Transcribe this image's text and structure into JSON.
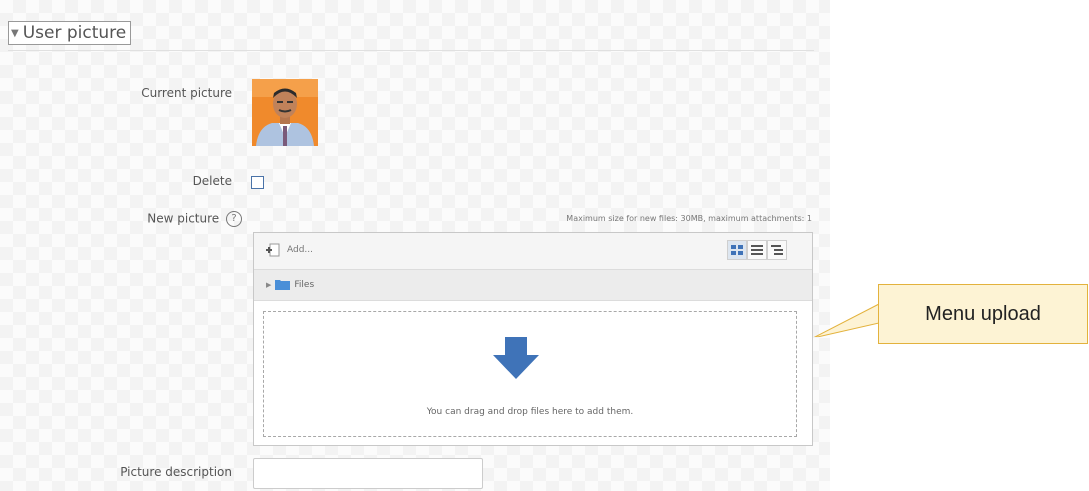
{
  "section": {
    "title": "User picture"
  },
  "current_picture": {
    "label": "Current picture"
  },
  "delete": {
    "label": "Delete",
    "checked": false
  },
  "new_picture": {
    "label": "New picture",
    "max_size_text": "Maximum size for new files: 30MB, maximum attachments: 1"
  },
  "filemanager": {
    "add_label": "Add...",
    "path_folder": "Files",
    "drop_text": "You can drag and drop files here to add them.",
    "view_modes": [
      "icons-view",
      "list-view",
      "tree-view"
    ],
    "active_view": "icons-view"
  },
  "picture_description": {
    "label": "Picture description",
    "value": ""
  },
  "callout": {
    "text": "Menu upload"
  },
  "colors": {
    "accent_blue": "#3f73b8",
    "callout_fill": "#fdf3d4",
    "callout_border": "#e3b23c"
  }
}
